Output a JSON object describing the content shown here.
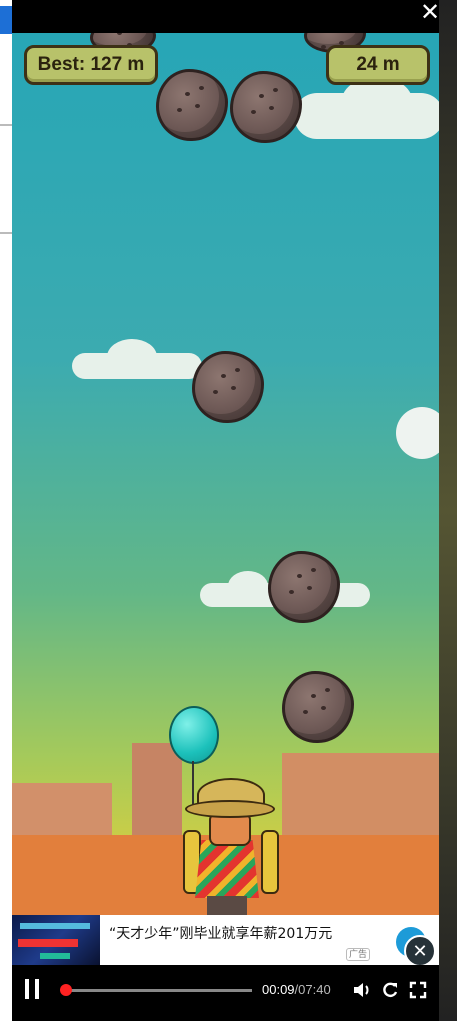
{
  "window": {
    "close_glyph": "✕"
  },
  "game": {
    "best_label": "Best: 127 m",
    "distance_label": "24 m",
    "colors": {
      "sky_top": "#27a6b6",
      "sky_bottom": "#e6c43a",
      "score_pill": "#b8c26a",
      "balloon": "#1cc1bb"
    }
  },
  "ad": {
    "text": "“天才少年”刚毕业就享年薪201万元",
    "tag": "广告",
    "close_glyph": "✕"
  },
  "player": {
    "progress_fraction": 0.0195,
    "current_time": "00:09",
    "separator": "/",
    "duration": "07:40",
    "icons": {
      "pause": "pause-icon",
      "volume": "volume-icon",
      "replay": "replay-icon",
      "fullscreen": "fullscreen-icon"
    }
  }
}
